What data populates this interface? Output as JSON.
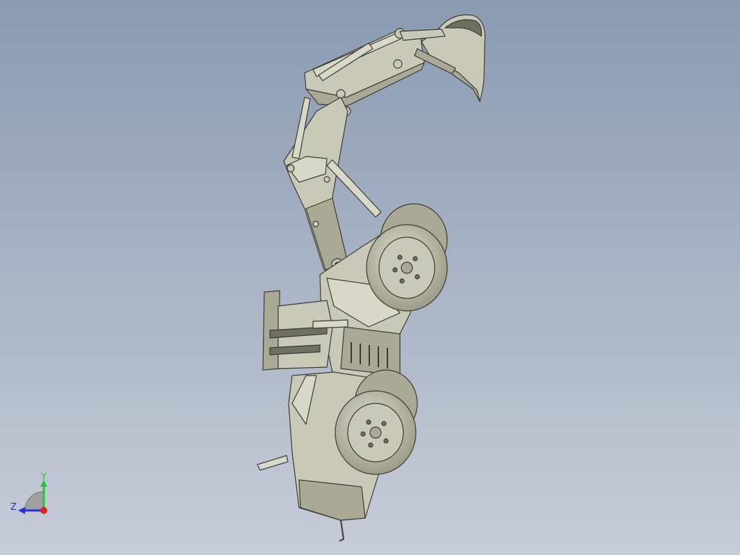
{
  "viewport": {
    "background_top": "#8a9bb2",
    "background_bottom": "#c8ccd8"
  },
  "model": {
    "body_color": "#c9c9b8",
    "shade_color": "#a9a995",
    "dark_color": "#6f6f62",
    "edge_color": "#3a3a34"
  },
  "triad": {
    "y_label": "Y",
    "z_label": "Z",
    "y_color": "#22c832",
    "z_color": "#2a2ad8",
    "x_color": "#e02020"
  }
}
